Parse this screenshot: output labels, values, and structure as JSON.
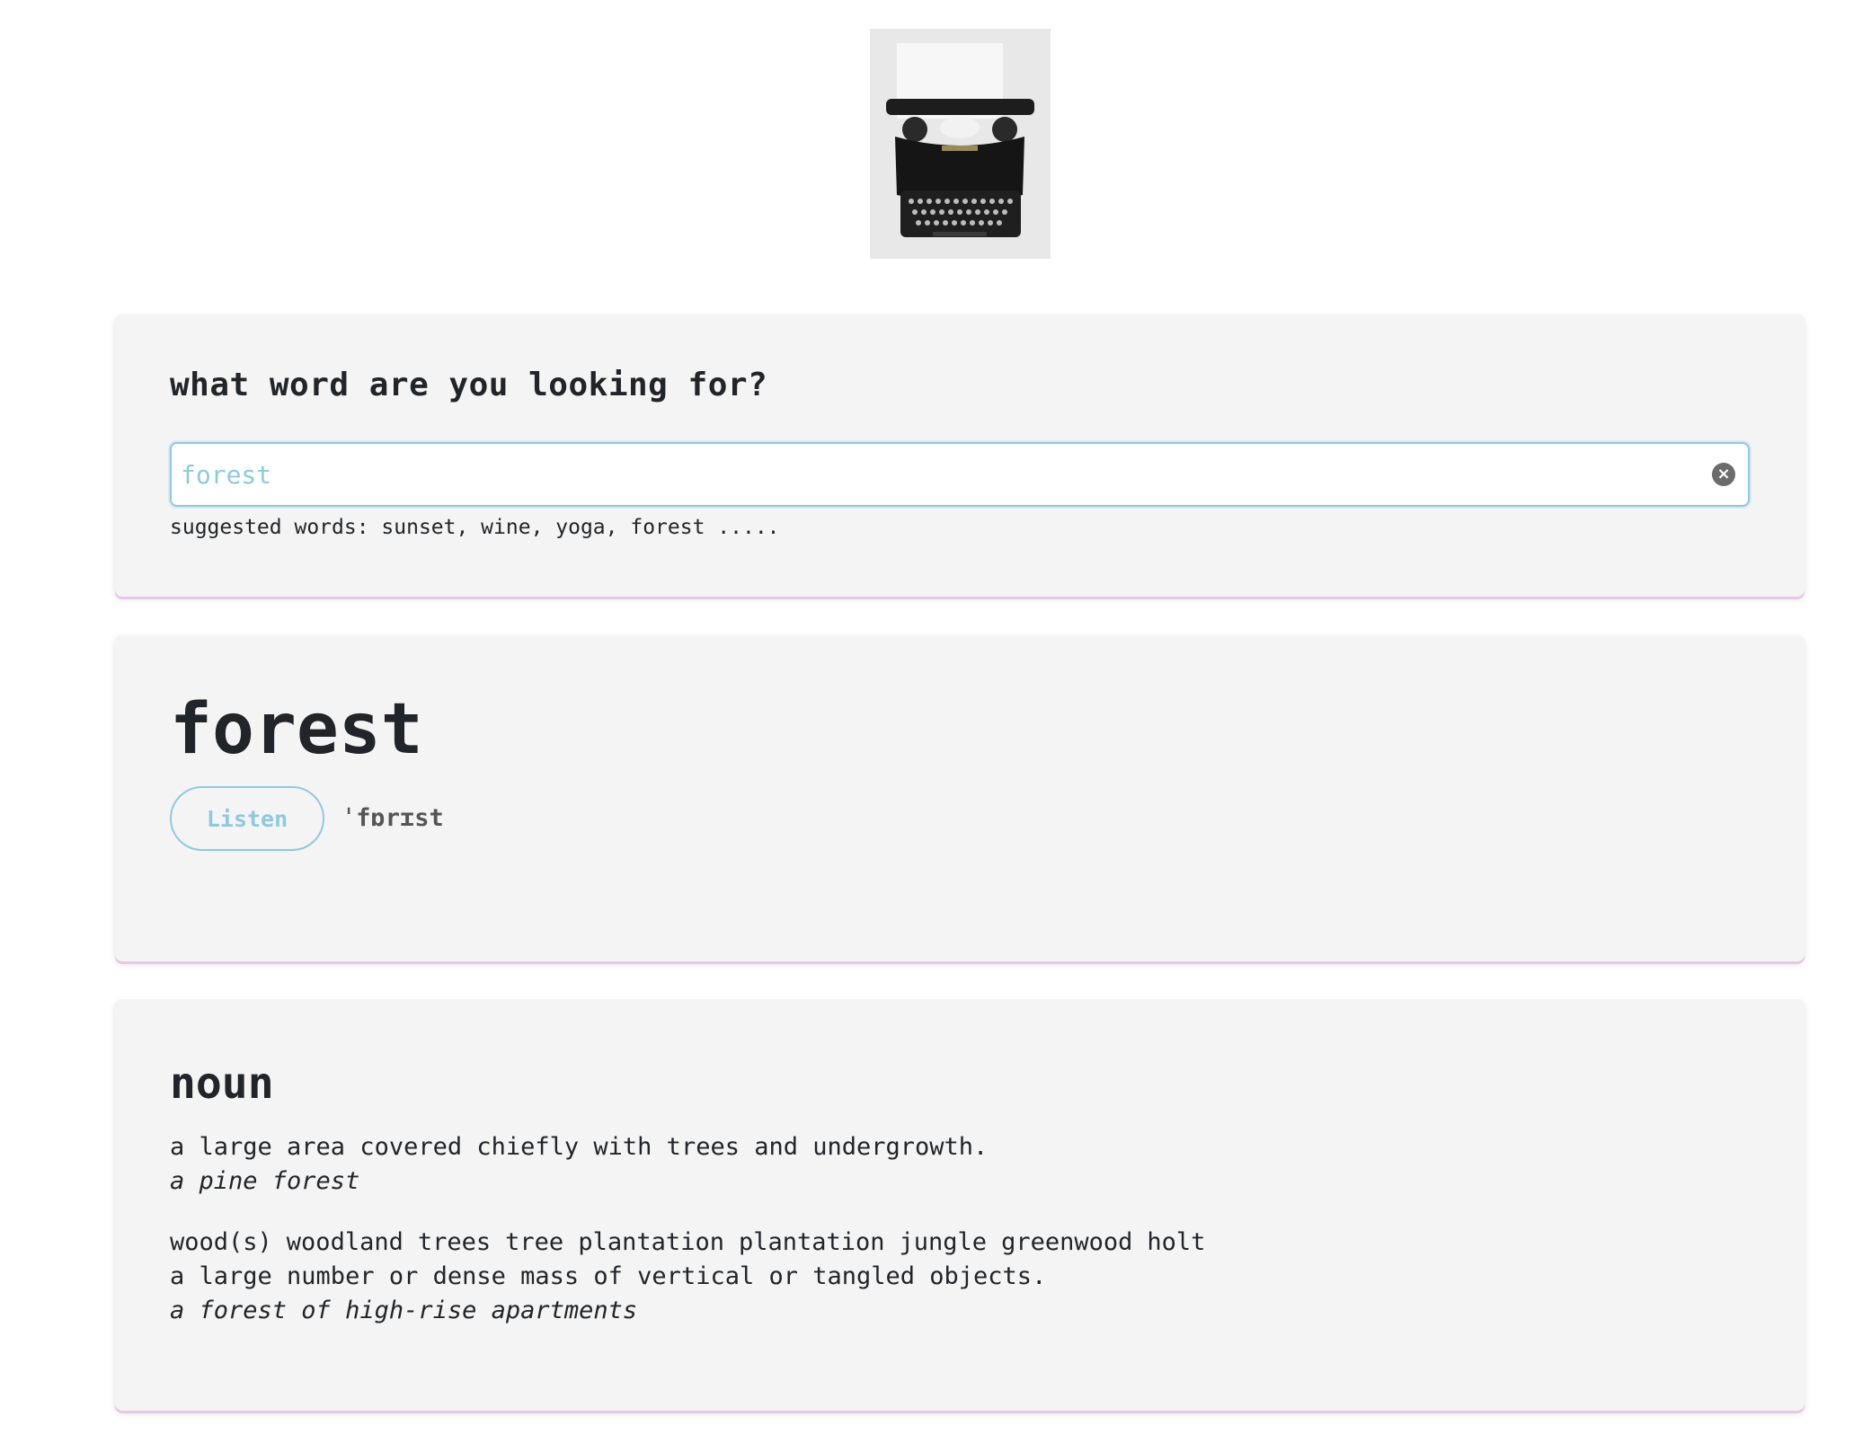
{
  "search": {
    "heading": "what word are you looking for?",
    "value": "forest",
    "clear_icon": "×",
    "suggested": "suggested words: sunset, wine, yoga, forest ....."
  },
  "word": {
    "title": "forest",
    "listen_label": "Listen",
    "phonetic": "ˈfɒrɪst"
  },
  "meaning": {
    "part_of_speech": "noun",
    "definitions": [
      {
        "definition": "a large area covered chiefly with trees and undergrowth.",
        "example": "a pine forest"
      },
      {
        "definition": "a large number or dense mass of vertical or tangled objects.",
        "example": "a forest of high-rise apartments"
      }
    ],
    "synonyms": [
      "wood(s)",
      "woodland",
      "trees",
      "tree plantation",
      "plantation",
      "jungle",
      "greenwood",
      "holt"
    ]
  },
  "colors": {
    "accent": "#8ec9e0",
    "card_background": "#f4f4f4",
    "card_border": "#e4c8e4",
    "text": "#212529"
  },
  "icons": {
    "logo": "typewriter-image",
    "clear": "clear-icon"
  }
}
